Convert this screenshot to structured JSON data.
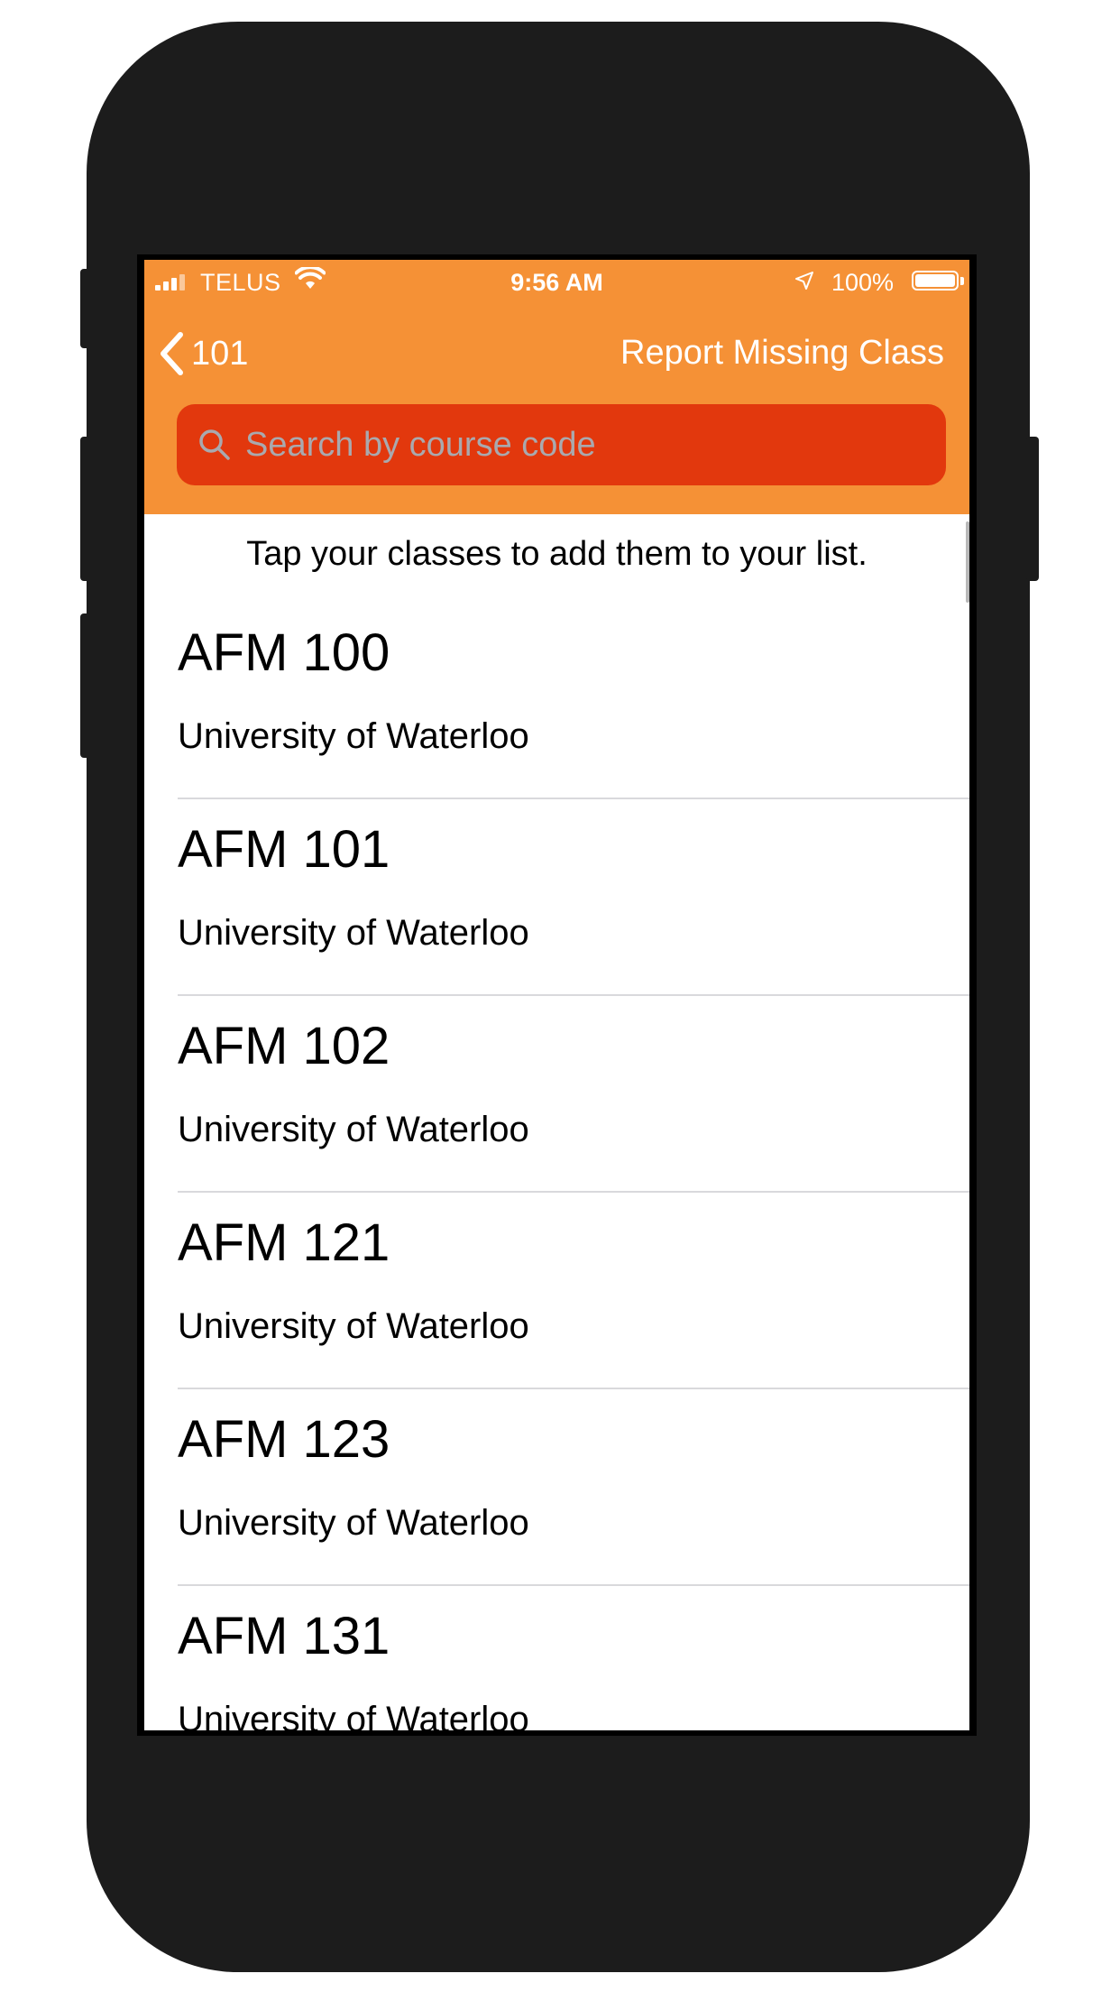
{
  "status_bar": {
    "carrier": "TELUS",
    "time": "9:56 AM",
    "battery": "100%"
  },
  "nav": {
    "back_label": "101",
    "action_label": "Report Missing Class"
  },
  "search": {
    "placeholder": "Search by course code",
    "value": ""
  },
  "hint": "Tap your classes to add them to your list.",
  "courses": [
    {
      "code": "AFM 100",
      "school": "University of Waterloo"
    },
    {
      "code": "AFM 101",
      "school": "University of Waterloo"
    },
    {
      "code": "AFM 102",
      "school": "University of Waterloo"
    },
    {
      "code": "AFM 121",
      "school": "University of Waterloo"
    },
    {
      "code": "AFM 123",
      "school": "University of Waterloo"
    },
    {
      "code": "AFM 131",
      "school": "University of Waterloo"
    }
  ],
  "colors": {
    "header": "#f59136",
    "search_field": "#e2380d",
    "frame": "#1c1c1c"
  }
}
